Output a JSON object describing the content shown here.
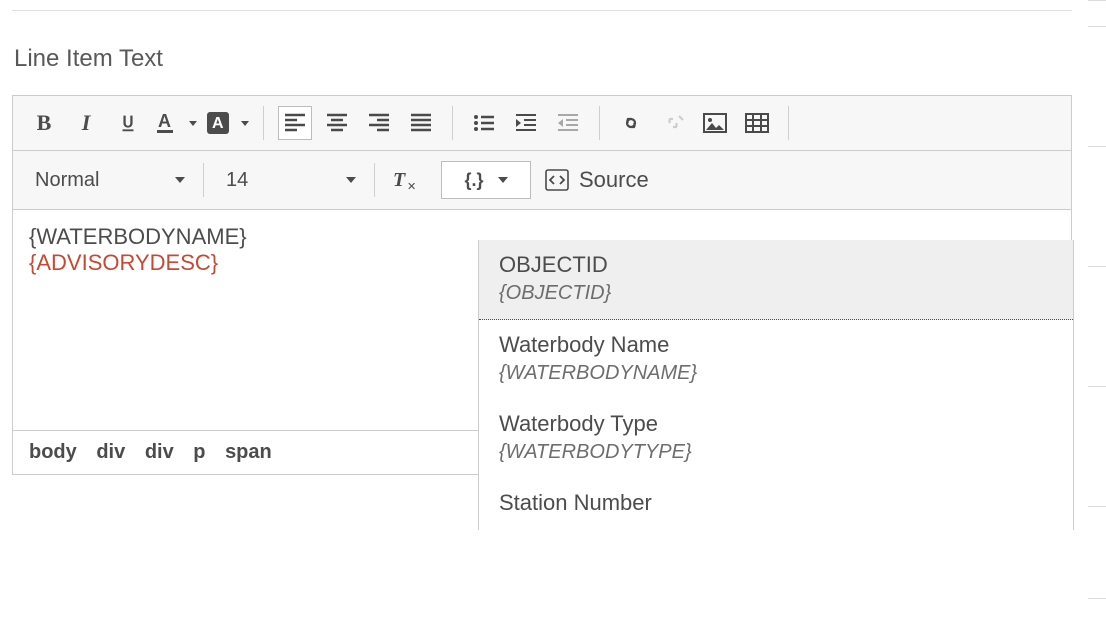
{
  "section": {
    "title": "Line Item Text"
  },
  "toolbar": {
    "format_select": "Normal",
    "size_select": "14",
    "insert_label": "{.}",
    "source_label": "Source"
  },
  "content": {
    "line1": "{WATERBODYNAME}",
    "line2": "{ADVISORYDESC}"
  },
  "path": [
    "body",
    "div",
    "div",
    "p",
    "span"
  ],
  "dropdown": {
    "items": [
      {
        "label": "OBJECTID",
        "token": "{OBJECTID}"
      },
      {
        "label": "Waterbody Name",
        "token": "{WATERBODYNAME}"
      },
      {
        "label": "Waterbody Type",
        "token": "{WATERBODYTYPE}"
      },
      {
        "label": "Station Number",
        "token": ""
      }
    ]
  },
  "icons": {
    "bold": "B",
    "italic": "I",
    "underline": "U",
    "textcolor": "A",
    "highlight": "A"
  },
  "colors": {
    "advisory": "#c54933"
  }
}
